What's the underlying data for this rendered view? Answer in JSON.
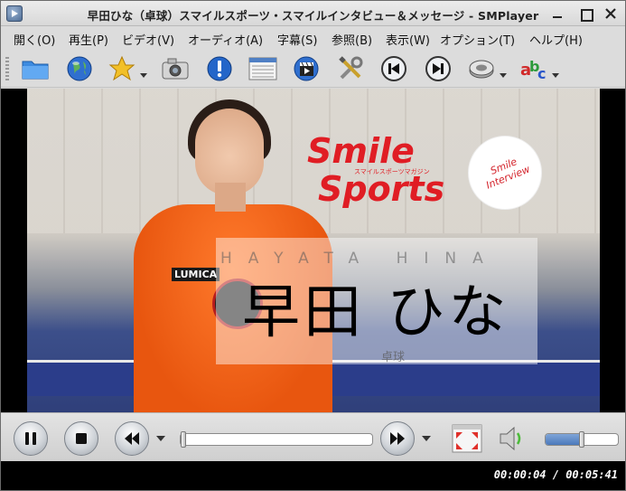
{
  "window": {
    "title": "早田ひな（卓球）スマイルスポーツ・スマイルインタビュー＆メッセージ - SMPlayer"
  },
  "menubar": {
    "items": [
      {
        "label": "開く(O)"
      },
      {
        "label": "再生(P)"
      },
      {
        "label": "ビデオ(V)"
      },
      {
        "label": "オーディオ(A)"
      },
      {
        "label": "字幕(S)"
      },
      {
        "label": "参照(B)"
      },
      {
        "label": "表示(W)"
      },
      {
        "label": "オプション(T)"
      },
      {
        "label": "ヘルプ(H)"
      }
    ]
  },
  "toolbar": {
    "buttons": [
      {
        "icon": "folder-icon"
      },
      {
        "icon": "globe-icon"
      },
      {
        "icon": "star-favorites-icon",
        "has_dropdown": true
      },
      {
        "icon": "camera-screenshot-icon"
      },
      {
        "icon": "info-icon"
      },
      {
        "icon": "playlist-icon"
      },
      {
        "icon": "clapperboard-icon"
      },
      {
        "icon": "tools-preferences-icon"
      },
      {
        "icon": "previous-track-icon"
      },
      {
        "icon": "next-track-icon"
      },
      {
        "icon": "audio-track-icon",
        "has_dropdown": true
      },
      {
        "icon": "subtitle-abc-icon",
        "has_dropdown": true
      }
    ]
  },
  "video": {
    "logo_line1": "Smile",
    "logo_line2": "Sports",
    "logo_subtitle": "スマイルスポーツマガジン",
    "badge_text": "Smile Interview",
    "romaji": "HAYATA HINA",
    "name": "早田 ひな",
    "sport": "卓球",
    "jersey_text": "LUMICA"
  },
  "controls": {
    "seek_fraction": 0.0012,
    "volume_fraction": 0.5,
    "accent": "#4b79bb"
  },
  "status": {
    "time": "00:00:04 / 00:05:41"
  }
}
